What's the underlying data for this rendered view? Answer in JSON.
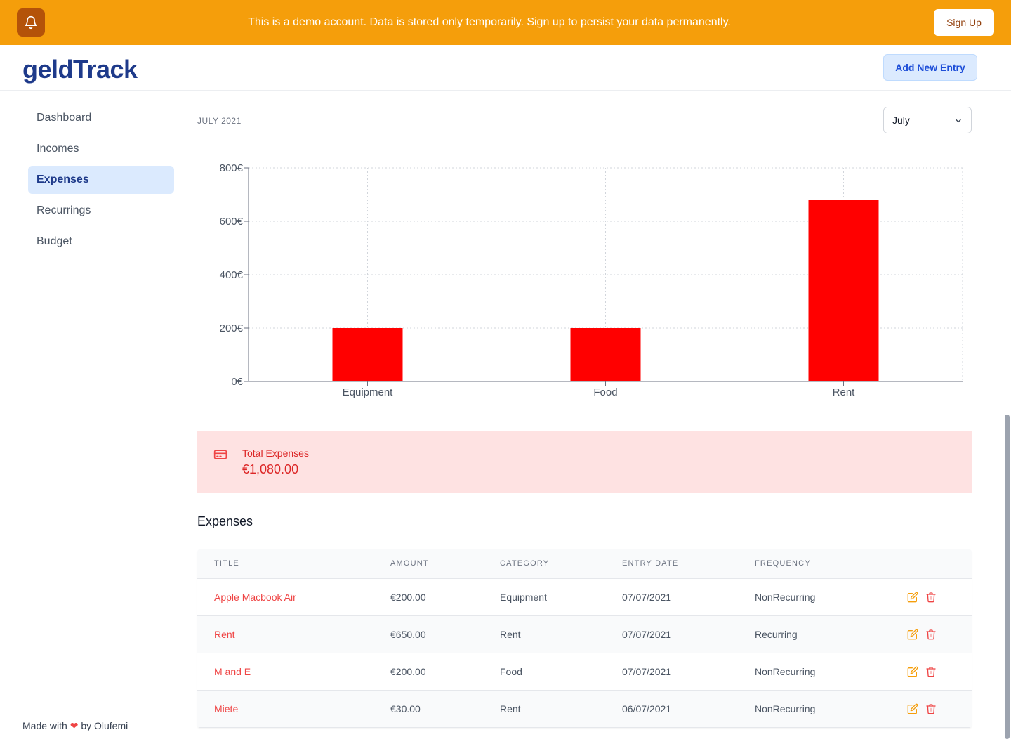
{
  "banner": {
    "message": "This is a demo account. Data is stored only temporarily. Sign up to persist your data permanently.",
    "signup_label": "Sign Up",
    "bell_icon": "bell-icon"
  },
  "header": {
    "logo": "geldTrack",
    "add_label": "Add New Entry"
  },
  "sidebar": {
    "items": [
      {
        "label": "Dashboard",
        "active": false
      },
      {
        "label": "Incomes",
        "active": false
      },
      {
        "label": "Expenses",
        "active": true
      },
      {
        "label": "Recurrings",
        "active": false
      },
      {
        "label": "Budget",
        "active": false
      }
    ],
    "footer_prefix": "Made with",
    "footer_suffix": "by Olufemi"
  },
  "main": {
    "period": "JULY 2021",
    "month_selected": "July"
  },
  "chart_data": {
    "type": "bar",
    "categories": [
      "Equipment",
      "Food",
      "Rent"
    ],
    "values": [
      200,
      200,
      680
    ],
    "yticks": [
      "0€",
      "200€",
      "400€",
      "600€",
      "800€"
    ],
    "ylim": [
      0,
      800
    ],
    "grid": true,
    "bar_color": "#ff0000"
  },
  "summary": {
    "label": "Total Expenses",
    "value": "€1,080.00",
    "icon": "credit-card-icon"
  },
  "table": {
    "title": "Expenses",
    "columns": [
      "TITLE",
      "AMOUNT",
      "CATEGORY",
      "ENTRY DATE",
      "FREQUENCY"
    ],
    "rows": [
      {
        "title": "Apple Macbook Air",
        "amount": "€200.00",
        "category": "Equipment",
        "date": "07/07/2021",
        "frequency": "NonRecurring"
      },
      {
        "title": "Rent",
        "amount": "€650.00",
        "category": "Rent",
        "date": "07/07/2021",
        "frequency": "Recurring"
      },
      {
        "title": "M and E",
        "amount": "€200.00",
        "category": "Food",
        "date": "07/07/2021",
        "frequency": "NonRecurring"
      },
      {
        "title": "Miete",
        "amount": "€30.00",
        "category": "Rent",
        "date": "06/07/2021",
        "frequency": "NonRecurring"
      }
    ]
  },
  "colors": {
    "banner": "#f59e0b",
    "brand": "#1e3a8a",
    "danger": "#ef4444",
    "edit": "#f59e0b"
  }
}
